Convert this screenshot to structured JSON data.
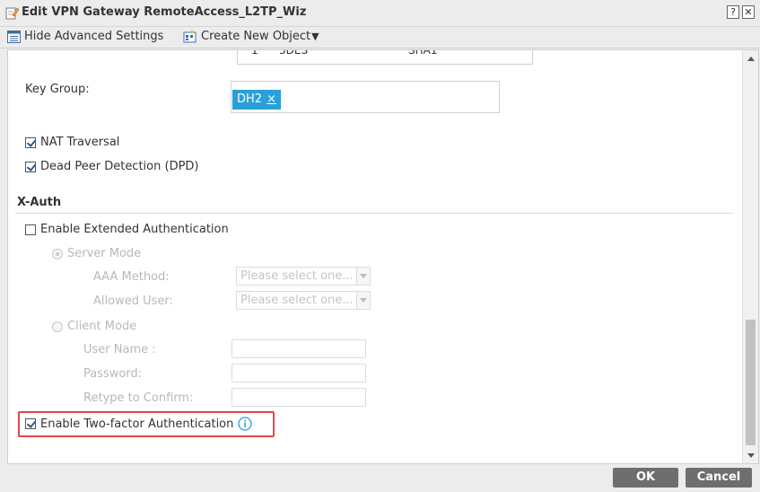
{
  "window": {
    "title": "Edit VPN Gateway RemoteAccess_L2TP_Wiz",
    "help_glyph": "?",
    "close_glyph": "✕"
  },
  "toolbar": {
    "hide_advanced": "Hide Advanced Settings",
    "create_object": "Create New Object",
    "create_object_arrow": "▼"
  },
  "proposal_row": {
    "index": "1",
    "encryption": "3DES",
    "authentication": "SHA1"
  },
  "key_group": {
    "label": "Key Group:",
    "tag": "DH2",
    "tag_remove": "×"
  },
  "nat_traversal": {
    "label": "NAT Traversal",
    "checked": true
  },
  "dpd": {
    "label": "Dead Peer Detection (DPD)",
    "checked": true
  },
  "xauth": {
    "section_title": "X-Auth",
    "enable_ext_auth": "Enable Extended Authentication",
    "server_mode": "Server Mode",
    "aaa_method_label": "AAA Method:",
    "aaa_method_placeholder": "Please select one...",
    "allowed_user_label": "Allowed User:",
    "allowed_user_placeholder": "Please select one...",
    "client_mode": "Client Mode",
    "user_name_label": "User Name :",
    "password_label": "Password:",
    "retype_label": "Retype to Confirm:",
    "two_factor": "Enable Two-factor Authentication"
  },
  "footer": {
    "ok": "OK",
    "cancel": "Cancel"
  },
  "colors": {
    "tag_blue": "#2a9fd8",
    "highlight_red": "#e0474c",
    "button_gray": "#6e6e6e"
  }
}
